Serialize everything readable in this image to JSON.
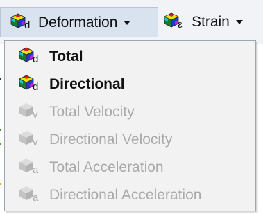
{
  "toolbar": {
    "deformation": {
      "label": "Deformation",
      "icon": "deformation-icon",
      "subscript": "d"
    },
    "strain": {
      "label": "Strain",
      "icon": "strain-icon",
      "subscript": "ε"
    }
  },
  "menu": {
    "items": [
      {
        "label": "Total",
        "enabled": true,
        "icon": "deformation-icon",
        "subscript": "d"
      },
      {
        "label": "Directional",
        "enabled": true,
        "icon": "deformation-icon",
        "subscript": "d"
      },
      {
        "label": "Total Velocity",
        "enabled": false,
        "icon": "velocity-icon",
        "subscript": "v"
      },
      {
        "label": "Directional Velocity",
        "enabled": false,
        "icon": "velocity-icon",
        "subscript": "v"
      },
      {
        "label": "Total Acceleration",
        "enabled": false,
        "icon": "acceleration-icon",
        "subscript": "a"
      },
      {
        "label": "Directional Acceleration",
        "enabled": false,
        "icon": "acceleration-icon",
        "subscript": "a"
      }
    ]
  },
  "colors": {
    "toolbar_bg": "#f1f3f7",
    "pressed_bg": "#d9e3ef",
    "menu_bg": "#f2f2f2",
    "menu_border": "#9ea6b0",
    "text": "#111111",
    "disabled_text": "#a9a9a9"
  }
}
